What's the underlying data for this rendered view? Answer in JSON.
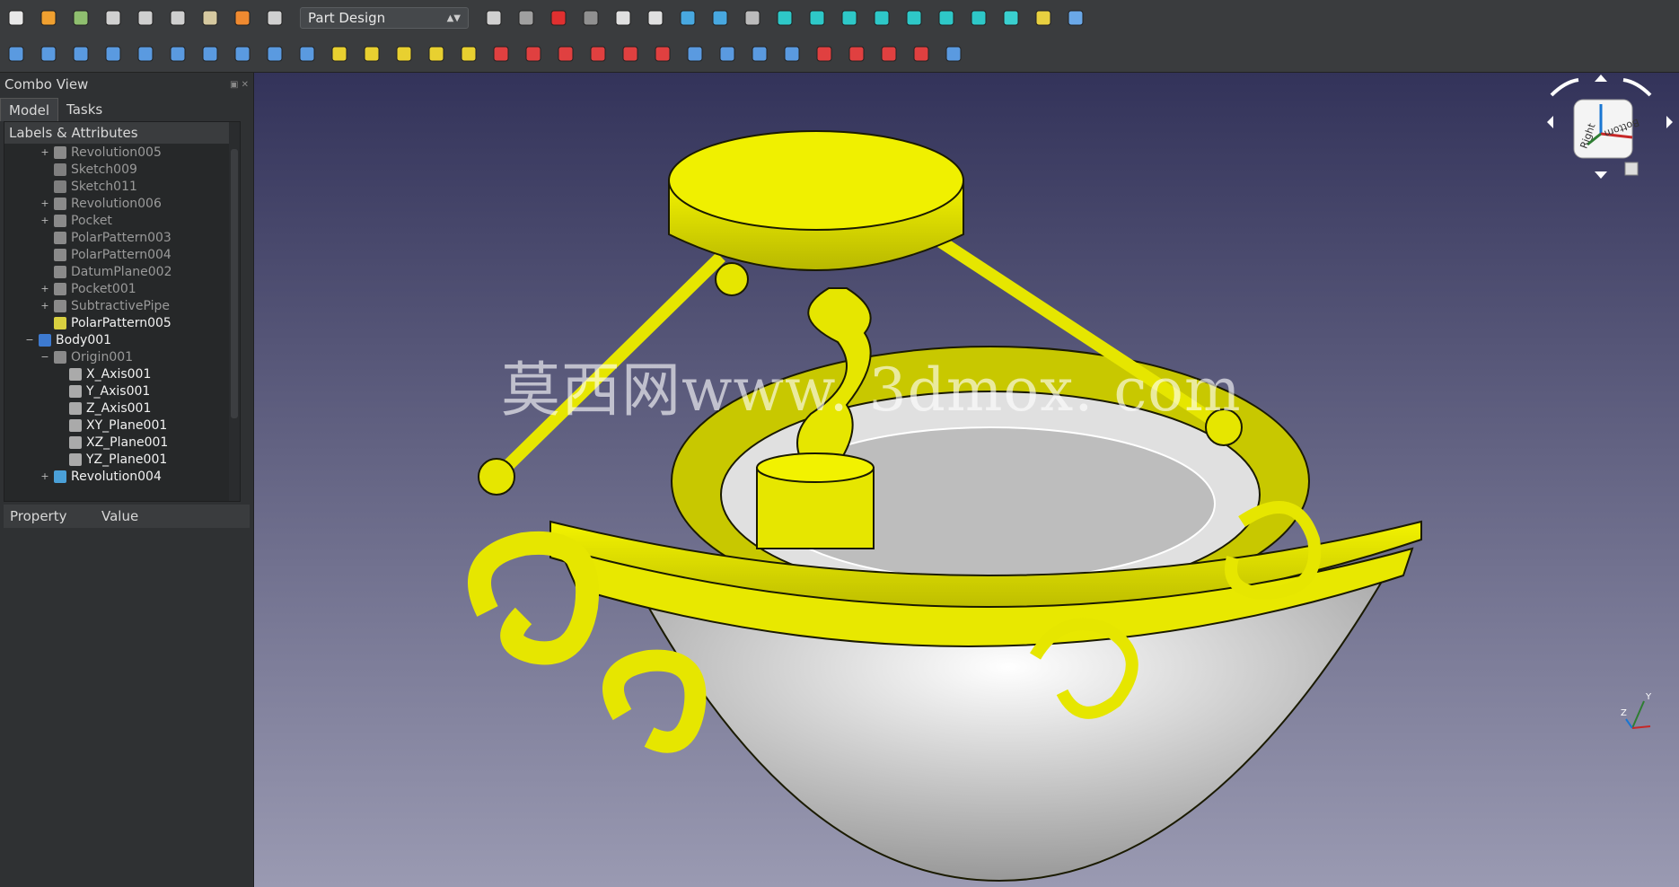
{
  "toolbar": {
    "workbench": "Part Design",
    "row1_icons": [
      "new-icon",
      "open-icon",
      "save-icon",
      "print-icon",
      "cut-icon",
      "copy-icon",
      "paste-icon",
      "undo-icon",
      "redo-icon",
      "refresh-icon",
      "whats-this-icon",
      "record-macro-icon",
      "stop-macro-icon",
      "edit-macro-icon",
      "run-macro-icon",
      "fit-all-icon",
      "fit-selection-icon",
      "draw-style-icon",
      "view-isometric-icon",
      "view-front-icon",
      "view-top-icon",
      "view-right-icon",
      "view-rear-icon",
      "view-bottom-icon",
      "view-left-icon",
      "measure-icon",
      "part-icon",
      "group-icon"
    ],
    "row2_icons": [
      "create-body-icon",
      "create-sketch-icon",
      "validate-sketch-icon",
      "clone-icon",
      "datum-point-icon",
      "datum-line-icon",
      "datum-plane-icon",
      "local-cs-icon",
      "shape-binder-icon",
      "subshape-binder-icon",
      "pad-icon",
      "revolution-icon",
      "loft-icon",
      "pipe-icon",
      "additive-primitive-icon",
      "pocket-icon",
      "hole-icon",
      "groove-icon",
      "subtractive-loft-icon",
      "subtractive-pipe-icon",
      "subtractive-primitive-icon",
      "mirrored-icon",
      "linear-pattern-icon",
      "polar-pattern-icon",
      "multitransform-icon",
      "fillet-icon",
      "chamfer-icon",
      "draft-icon",
      "thickness-icon",
      "boolean-icon"
    ]
  },
  "combo": {
    "title": "Combo View",
    "tabs": [
      "Model",
      "Tasks"
    ],
    "tree_header": "Labels & Attributes",
    "tree": [
      {
        "label": "Revolution005",
        "expander": "+",
        "icon": "revolution",
        "style": "dim",
        "indent": 1
      },
      {
        "label": "Sketch009",
        "expander": "",
        "icon": "sketch",
        "style": "dim",
        "indent": 1
      },
      {
        "label": "Sketch011",
        "expander": "",
        "icon": "sketch",
        "style": "dim",
        "indent": 1
      },
      {
        "label": "Revolution006",
        "expander": "+",
        "icon": "revolution",
        "style": "dim",
        "indent": 1
      },
      {
        "label": "Pocket",
        "expander": "+",
        "icon": "pocket",
        "style": "dim",
        "indent": 1
      },
      {
        "label": "PolarPattern003",
        "expander": "",
        "icon": "polar-pattern",
        "style": "dim",
        "indent": 1
      },
      {
        "label": "PolarPattern004",
        "expander": "",
        "icon": "polar-pattern",
        "style": "dim",
        "indent": 1
      },
      {
        "label": "DatumPlane002",
        "expander": "",
        "icon": "datum-plane",
        "style": "dim",
        "indent": 1
      },
      {
        "label": "Pocket001",
        "expander": "+",
        "icon": "pocket",
        "style": "dim",
        "indent": 1
      },
      {
        "label": "SubtractivePipe",
        "expander": "+",
        "icon": "pipe",
        "style": "dim",
        "indent": 1
      },
      {
        "label": "PolarPattern005",
        "expander": "",
        "icon": "polar-pattern-active",
        "style": "bright",
        "indent": 1
      },
      {
        "label": "Body001",
        "expander": "−",
        "icon": "body",
        "style": "bright",
        "indent": 0
      },
      {
        "label": "Origin001",
        "expander": "−",
        "icon": "origin",
        "style": "dim",
        "indent": 1
      },
      {
        "label": "X_Axis001",
        "expander": "",
        "icon": "axis",
        "style": "bright",
        "indent": 2
      },
      {
        "label": "Y_Axis001",
        "expander": "",
        "icon": "axis",
        "style": "bright",
        "indent": 2
      },
      {
        "label": "Z_Axis001",
        "expander": "",
        "icon": "axis",
        "style": "bright",
        "indent": 2
      },
      {
        "label": "XY_Plane001",
        "expander": "",
        "icon": "plane",
        "style": "bright",
        "indent": 2
      },
      {
        "label": "XZ_Plane001",
        "expander": "",
        "icon": "plane",
        "style": "bright",
        "indent": 2
      },
      {
        "label": "YZ_Plane001",
        "expander": "",
        "icon": "plane",
        "style": "bright",
        "indent": 2
      },
      {
        "label": "Revolution004",
        "expander": "+",
        "icon": "revolution-active",
        "style": "bright",
        "indent": 1
      }
    ],
    "property_header": "Property",
    "value_header": "Value"
  },
  "viewport": {
    "watermark": "莫西网www. 3dmox. com",
    "navcube_face_right": "Right",
    "navcube_face_bottom": "Bottom",
    "axis_y": "Y",
    "axis_z": "Z",
    "model_color": "#e6e600",
    "background_top": "#33335a",
    "background_bottom": "#9a9ab2"
  }
}
